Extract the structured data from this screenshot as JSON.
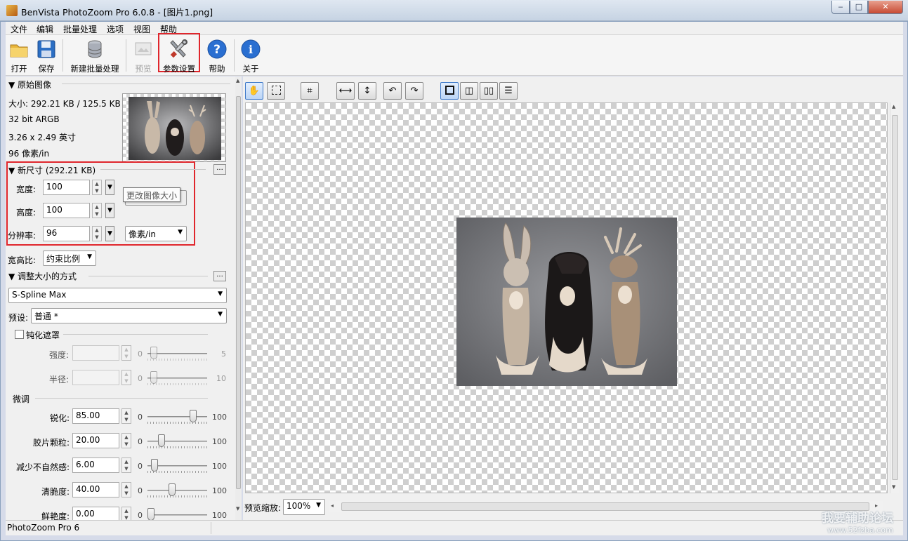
{
  "window": {
    "title": "BenVista PhotoZoom Pro 6.0.8 - [图片1.png]",
    "min": "‒",
    "max": "□",
    "close": "✕"
  },
  "menu": [
    "文件",
    "编辑",
    "批量处理",
    "选项",
    "视图",
    "帮助"
  ],
  "toolbar": {
    "open": "打开",
    "save": "保存",
    "batch": "新建批量处理",
    "preview": "预览",
    "settings": "参数设置",
    "help": "帮助",
    "about": "关于"
  },
  "original": {
    "header": "▼ 原始图像",
    "size": "大小: 292.21 KB / 125.5 KB",
    "bits": "32 bit ARGB",
    "dims": "3.26 x 2.49 英寸",
    "dpi": "96 像素/in"
  },
  "newsize": {
    "header": "▼ 新尺寸 (292.21 KB)",
    "width_label": "宽度:",
    "width": "100",
    "height_label": "高度:",
    "height": "100",
    "res_label": "分辨率:",
    "res": "96",
    "unit": "像素/in",
    "tooltip": "更改图像大小",
    "more": "..."
  },
  "aspect": {
    "label": "宽高比:",
    "value": "约束比例"
  },
  "method": {
    "header": "▼ 调整大小的方式",
    "algorithm": "S-Spline Max",
    "preset_label": "预设:",
    "preset": "普通 *",
    "more": "..."
  },
  "unsharp": {
    "header": "钝化遮罩",
    "strength_label": "强度:",
    "strength_min": "0",
    "strength_max": "5",
    "strength_level": 0.05,
    "radius_label": "半径:",
    "radius_min": "0",
    "radius_max": "10",
    "radius_level": 0.05
  },
  "finetune": {
    "header": "微调",
    "rows": [
      {
        "label": "锐化:",
        "value": "85.00",
        "min": "0",
        "max": "100",
        "level": 0.8
      },
      {
        "label": "胶片颗粒:",
        "value": "20.00",
        "min": "0",
        "max": "100",
        "level": 0.2
      },
      {
        "label": "减少不自然感:",
        "value": "6.00",
        "min": "0",
        "max": "100",
        "level": 0.06
      },
      {
        "label": "清脆度:",
        "value": "40.00",
        "min": "0",
        "max": "100",
        "level": 0.4
      },
      {
        "label": "鲜艳度:",
        "value": "0.00",
        "min": "0",
        "max": "100",
        "level": 0.0
      }
    ]
  },
  "preview": {
    "zoom_label": "预览缩放:",
    "zoom": "100%"
  },
  "status": "PhotoZoom Pro 6",
  "watermark": {
    "line1": "我要辅助论坛",
    "line2": "www.52fzba.com"
  }
}
